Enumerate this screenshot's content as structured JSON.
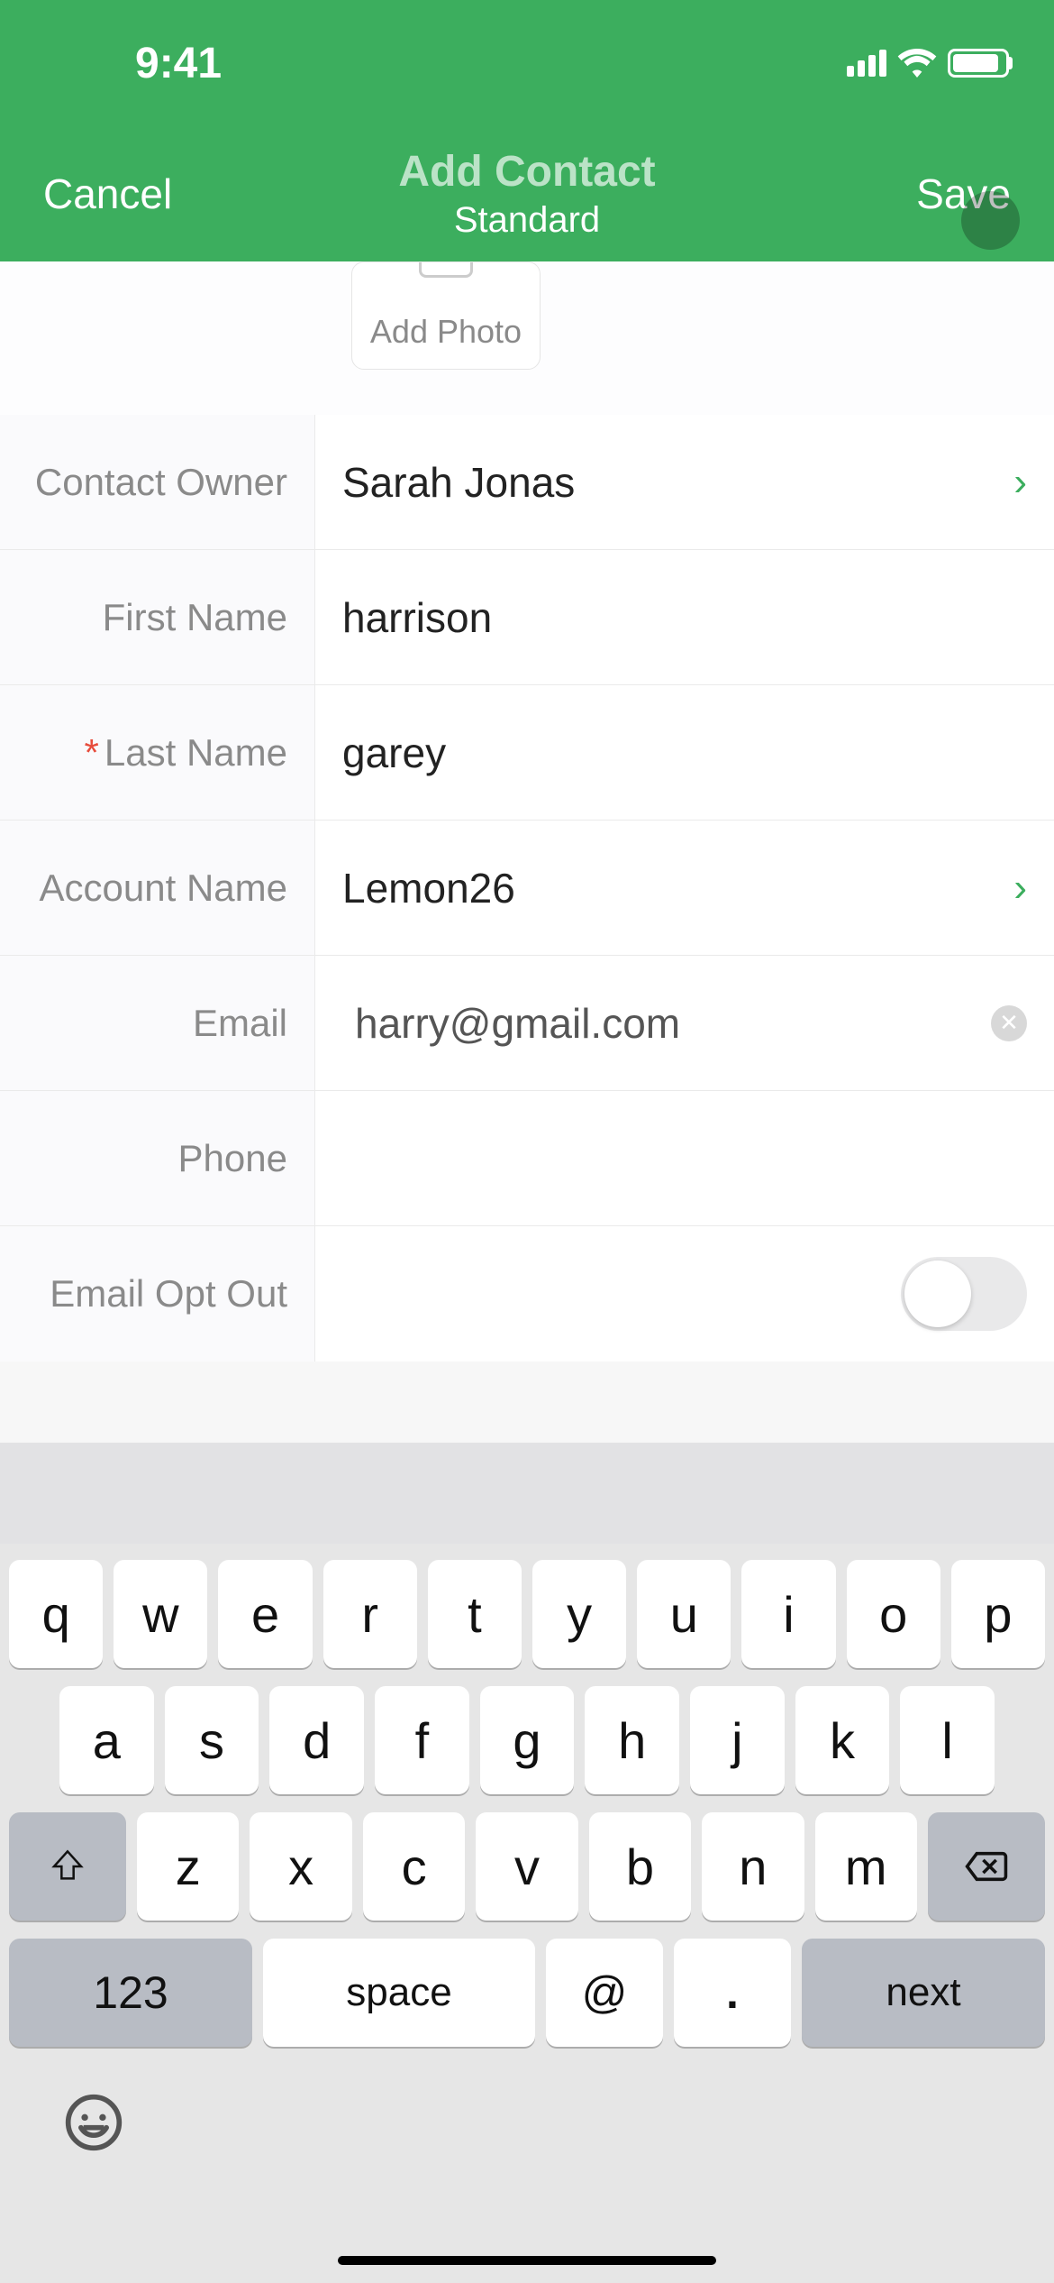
{
  "status": {
    "time": "9:41"
  },
  "nav": {
    "cancel": "Cancel",
    "title": "Add Contact",
    "subtitle": "Standard",
    "save": "Save"
  },
  "photo": {
    "label": "Add Photo"
  },
  "fields": {
    "owner": {
      "label": "Contact Owner",
      "value": "Sarah Jonas"
    },
    "first_name": {
      "label": "First Name",
      "value": "harrison"
    },
    "last_name": {
      "label": "Last Name",
      "value": "garey"
    },
    "account": {
      "label": "Account Name",
      "value": "Lemon26"
    },
    "email": {
      "label": "Email",
      "value": "harry@gmail.com"
    },
    "phone": {
      "label": "Phone",
      "value": ""
    },
    "email_opt_out": {
      "label": "Email Opt Out"
    }
  },
  "keyboard": {
    "row1": [
      "q",
      "w",
      "e",
      "r",
      "t",
      "y",
      "u",
      "i",
      "o",
      "p"
    ],
    "row2": [
      "a",
      "s",
      "d",
      "f",
      "g",
      "h",
      "j",
      "k",
      "l"
    ],
    "row3": [
      "z",
      "x",
      "c",
      "v",
      "b",
      "n",
      "m"
    ],
    "num": "123",
    "space": "space",
    "at": "@",
    "dot": ".",
    "next": "next"
  }
}
